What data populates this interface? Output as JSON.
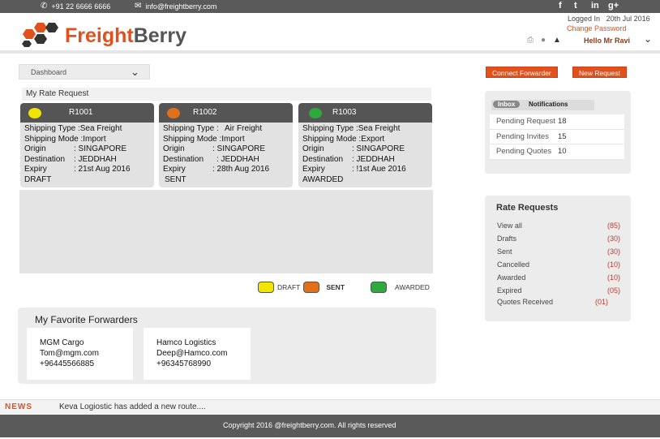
{
  "topbar": {
    "phone": "+91 22 6666 6666",
    "email": "info@freightberry.com",
    "social": [
      "f",
      "t",
      "in",
      "g+"
    ]
  },
  "header": {
    "brand_part1": "Freight",
    "brand_part2": "Berry",
    "logged_in": "Logged In",
    "logged_date": "20th Jul 2016",
    "change_password": "Change Password",
    "hello": "Hello Mr Ravi",
    "icons": [
      "printer-icon",
      "user-icon",
      "bell-icon"
    ]
  },
  "dashboard_select": {
    "value": "Dashboard"
  },
  "rate_section": {
    "title": "My Rate Request"
  },
  "requests": [
    {
      "id": "R1001",
      "dot_color": "#f2e600",
      "shipping_type_label": "Shipping Type : ",
      "shipping_type": "Sea Freight",
      "shipping_mode_label": "Shipping Mode : ",
      "shipping_mode": "Import",
      "origin_label": "Origin",
      "origin": ": SINGAPORE",
      "destination_label": "Destination",
      "destination": ": JEDDHAH",
      "expiry_label": "Expiry",
      "expiry": ": 21st Aug 2016",
      "status": "DRAFT"
    },
    {
      "id": "R1002",
      "dot_color": "#e2701b",
      "shipping_type_label": "Shipping Type :",
      "shipping_type": "Air Freight",
      "shipping_mode_label": "Shipping Mode : ",
      "shipping_mode": "Import",
      "origin_label": "Origin",
      "origin": ": SINGAPORE",
      "destination_label": "Destination",
      "destination": ": JEDDHAH",
      "expiry_label": "Expiry",
      "expiry": ": 28th Aug 2016",
      "status": "SENT"
    },
    {
      "id": "R1003",
      "dot_color": "#2eaa3c",
      "shipping_type_label": "Shipping Type : ",
      "shipping_type": "Sea Freight",
      "shipping_mode_label": "Shipping Mode :",
      "shipping_mode": "Export",
      "origin_label": "Origin",
      "origin": ": SINGAPORE",
      "destination_label": "Destination",
      "destination": ": JEDDHAH",
      "expiry_label": "Expiry",
      "expiry": ": !1st Aue 2016",
      "status": "AWARDED"
    }
  ],
  "legend": [
    {
      "label": "DRAFT",
      "color": "#f2e600"
    },
    {
      "label": "SENT",
      "color": "#e2701b"
    },
    {
      "label": "AWARDED",
      "color": "#2eaa3c"
    }
  ],
  "favorites": {
    "title": "My Favorite Forwarders",
    "items": [
      {
        "name": "MGM Cargo",
        "email": "Tom@mgm.com",
        "phone": "+96445566885"
      },
      {
        "name": "Hamco Logistics",
        "email": "Deep@Hamco.com",
        "phone": "+96345768990"
      }
    ]
  },
  "news": {
    "label": "NEWS",
    "text": "Keva Logiostic has added a new route...."
  },
  "footer": {
    "text": "Copyright 2016 @freightberry.com. All rights reserved"
  },
  "actions": {
    "connect": "Connect Forwarder",
    "new_request": "New Request"
  },
  "inbox": {
    "tab_inbox": "Inbox",
    "tab_notifications": "Notifications",
    "rows": [
      {
        "label": "Pending  Request",
        "value": "18"
      },
      {
        "label": "Pending  Invites",
        "value": "15"
      },
      {
        "label": "Pending  Quotes",
        "value": "10"
      }
    ]
  },
  "rate_requests": {
    "title": "Rate Requests",
    "rows": [
      {
        "label": "View all",
        "count": "(85)"
      },
      {
        "label": "Drafts",
        "count": "(30)"
      },
      {
        "label": "Sent",
        "count": "(30)"
      },
      {
        "label": "Cancelled",
        "count": "(10)"
      },
      {
        "label": "Awarded",
        "count": "(10)"
      },
      {
        "label": "Expired",
        "count": "(05)"
      },
      {
        "label": "Quotes Received",
        "count": "(01)"
      }
    ]
  },
  "colors": {
    "accent": "#e2501b",
    "dark_bar": "#5a5a5a"
  }
}
